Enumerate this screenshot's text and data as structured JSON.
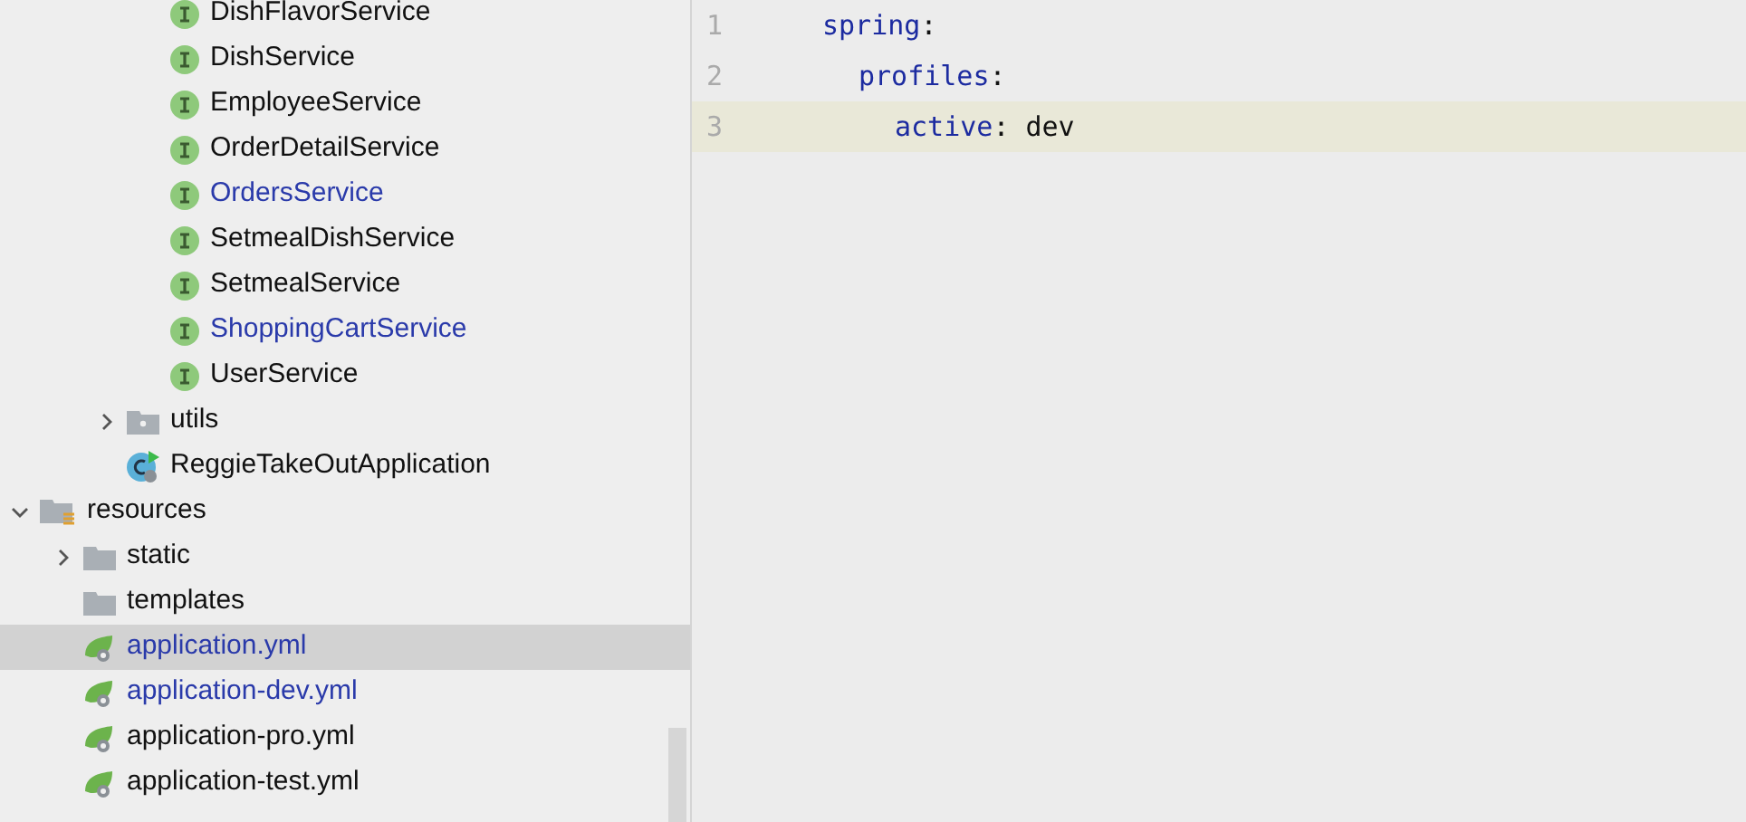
{
  "project_tree": [
    {
      "children": [
        {
          "children": [
            {
              "children": [
                {
                  "children": [
                    {
                      "label": "DishFlavorService",
                      "kind": "interface",
                      "modified": false,
                      "selected": false
                    },
                    {
                      "label": "DishService",
                      "kind": "interface",
                      "modified": false,
                      "selected": false
                    },
                    {
                      "label": "EmployeeService",
                      "kind": "interface",
                      "modified": false,
                      "selected": false
                    },
                    {
                      "label": "OrderDetailService",
                      "kind": "interface",
                      "modified": false,
                      "selected": false
                    },
                    {
                      "label": "OrdersService",
                      "kind": "interface",
                      "modified": true,
                      "selected": false
                    },
                    {
                      "label": "SetmealDishService",
                      "kind": "interface",
                      "modified": false,
                      "selected": false
                    },
                    {
                      "label": "SetmealService",
                      "kind": "interface",
                      "modified": false,
                      "selected": false
                    },
                    {
                      "label": "ShoppingCartService",
                      "kind": "interface",
                      "modified": true,
                      "selected": false
                    },
                    {
                      "label": "UserService",
                      "kind": "interface",
                      "modified": false,
                      "selected": false
                    }
                  ]
                },
                {
                  "label": "utils",
                  "kind": "package",
                  "expanded": false,
                  "modified": false,
                  "selected": false
                },
                {
                  "label": "ReggieTakeOutApplication",
                  "kind": "spring_app",
                  "modified": false,
                  "selected": false
                }
              ]
            }
          ]
        },
        {
          "label": "resources",
          "kind": "resources",
          "expanded": true,
          "modified": false,
          "selected": false,
          "children": [
            {
              "label": "static",
              "kind": "folder",
              "expanded": false,
              "modified": false,
              "selected": false
            },
            {
              "label": "templates",
              "kind": "folder",
              "modified": false,
              "selected": false
            },
            {
              "label": "application.yml",
              "kind": "yml",
              "modified": true,
              "selected": true
            },
            {
              "label": "application-dev.yml",
              "kind": "yml",
              "modified": true,
              "selected": false
            },
            {
              "label": "application-pro.yml",
              "kind": "yml",
              "modified": false,
              "selected": false
            },
            {
              "label": "application-test.yml",
              "kind": "yml",
              "modified": false,
              "selected": false
            }
          ]
        }
      ]
    }
  ],
  "editor": {
    "lines": [
      {
        "number": "1",
        "key": "spring",
        "colon": ":",
        "current": false,
        "children": [
          {
            "number": "2",
            "key": "profiles",
            "colon": ":",
            "current": false,
            "children": [
              {
                "number": "3",
                "key": "active",
                "colon": ":",
                "value": "dev",
                "current": true
              }
            ]
          }
        ]
      }
    ]
  }
}
